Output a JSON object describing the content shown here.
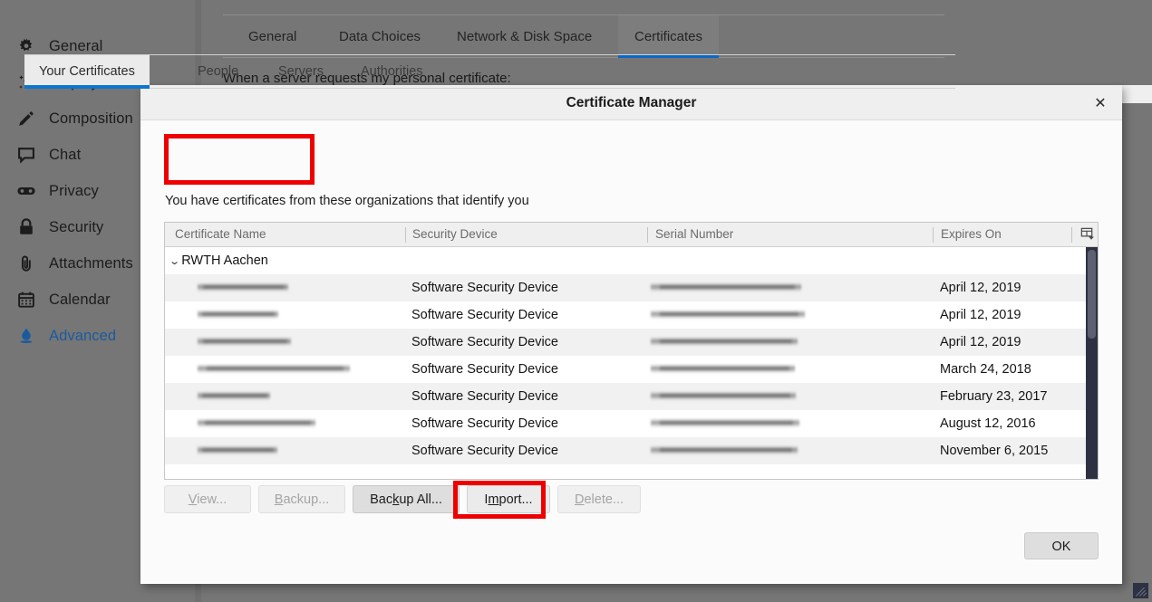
{
  "background": {
    "sidebar": {
      "items": [
        {
          "label": "General",
          "icon": "gear-icon",
          "active": false
        },
        {
          "label": "Display",
          "icon": "sparkle-icon",
          "active": false
        },
        {
          "label": "Composition",
          "icon": "pencil-icon",
          "active": false
        },
        {
          "label": "Chat",
          "icon": "chat-bubble-icon",
          "active": false
        },
        {
          "label": "Privacy",
          "icon": "mask-icon",
          "active": false
        },
        {
          "label": "Security",
          "icon": "lock-icon",
          "active": false
        },
        {
          "label": "Attachments",
          "icon": "paperclip-icon",
          "active": false
        },
        {
          "label": "Calendar",
          "icon": "calendar-icon",
          "active": false
        },
        {
          "label": "Advanced",
          "icon": "droplet-icon",
          "active": true
        }
      ]
    },
    "tabs": [
      {
        "label": "General",
        "selected": false
      },
      {
        "label": "Data Choices",
        "selected": false
      },
      {
        "label": "Network & Disk Space",
        "selected": false
      },
      {
        "label": "Certificates",
        "selected": true
      }
    ],
    "section_label": "When a server requests my personal certificate:"
  },
  "dialog": {
    "title": "Certificate Manager",
    "close_label": "✕",
    "tabs": [
      {
        "label": "Your Certificates",
        "selected": true
      },
      {
        "label": "People",
        "selected": false
      },
      {
        "label": "Servers",
        "selected": false
      },
      {
        "label": "Authorities",
        "selected": false
      }
    ],
    "description": "You have certificates from these organizations that identify you",
    "table": {
      "columns": [
        "Certificate Name",
        "Security Device",
        "Serial Number",
        "Expires On"
      ],
      "group": {
        "label": "RWTH Aachen",
        "twisty": "⌄",
        "expanded": true
      },
      "rows": [
        {
          "name": "",
          "device": "Software Security Device",
          "serial": "",
          "expires": "April 12, 2019"
        },
        {
          "name": "",
          "device": "Software Security Device",
          "serial": "",
          "expires": "April 12, 2019"
        },
        {
          "name": "",
          "device": "Software Security Device",
          "serial": "",
          "expires": "April 12, 2019"
        },
        {
          "name": "",
          "device": "Software Security Device",
          "serial": "",
          "expires": "March 24, 2018"
        },
        {
          "name": "",
          "device": "Software Security Device",
          "serial": "",
          "expires": "February 23, 2017"
        },
        {
          "name": "",
          "device": "Software Security Device",
          "serial": "",
          "expires": "August 12, 2016"
        },
        {
          "name": "",
          "device": "Software Security Device",
          "serial": "",
          "expires": "November 6, 2015"
        }
      ]
    },
    "buttons": [
      {
        "label": "View...",
        "accel": "V",
        "state": "disabled"
      },
      {
        "label": "Backup...",
        "accel": "B",
        "state": "disabled"
      },
      {
        "label": "Backup All...",
        "accel": "k",
        "state": "strong"
      },
      {
        "label": "Import...",
        "accel": "m",
        "state": "normal"
      },
      {
        "label": "Delete...",
        "accel": "D",
        "state": "disabled"
      }
    ],
    "ok_label": "OK"
  },
  "highlights": {
    "color": "#ee0000",
    "targets": [
      "Your Certificates",
      "Import..."
    ]
  }
}
